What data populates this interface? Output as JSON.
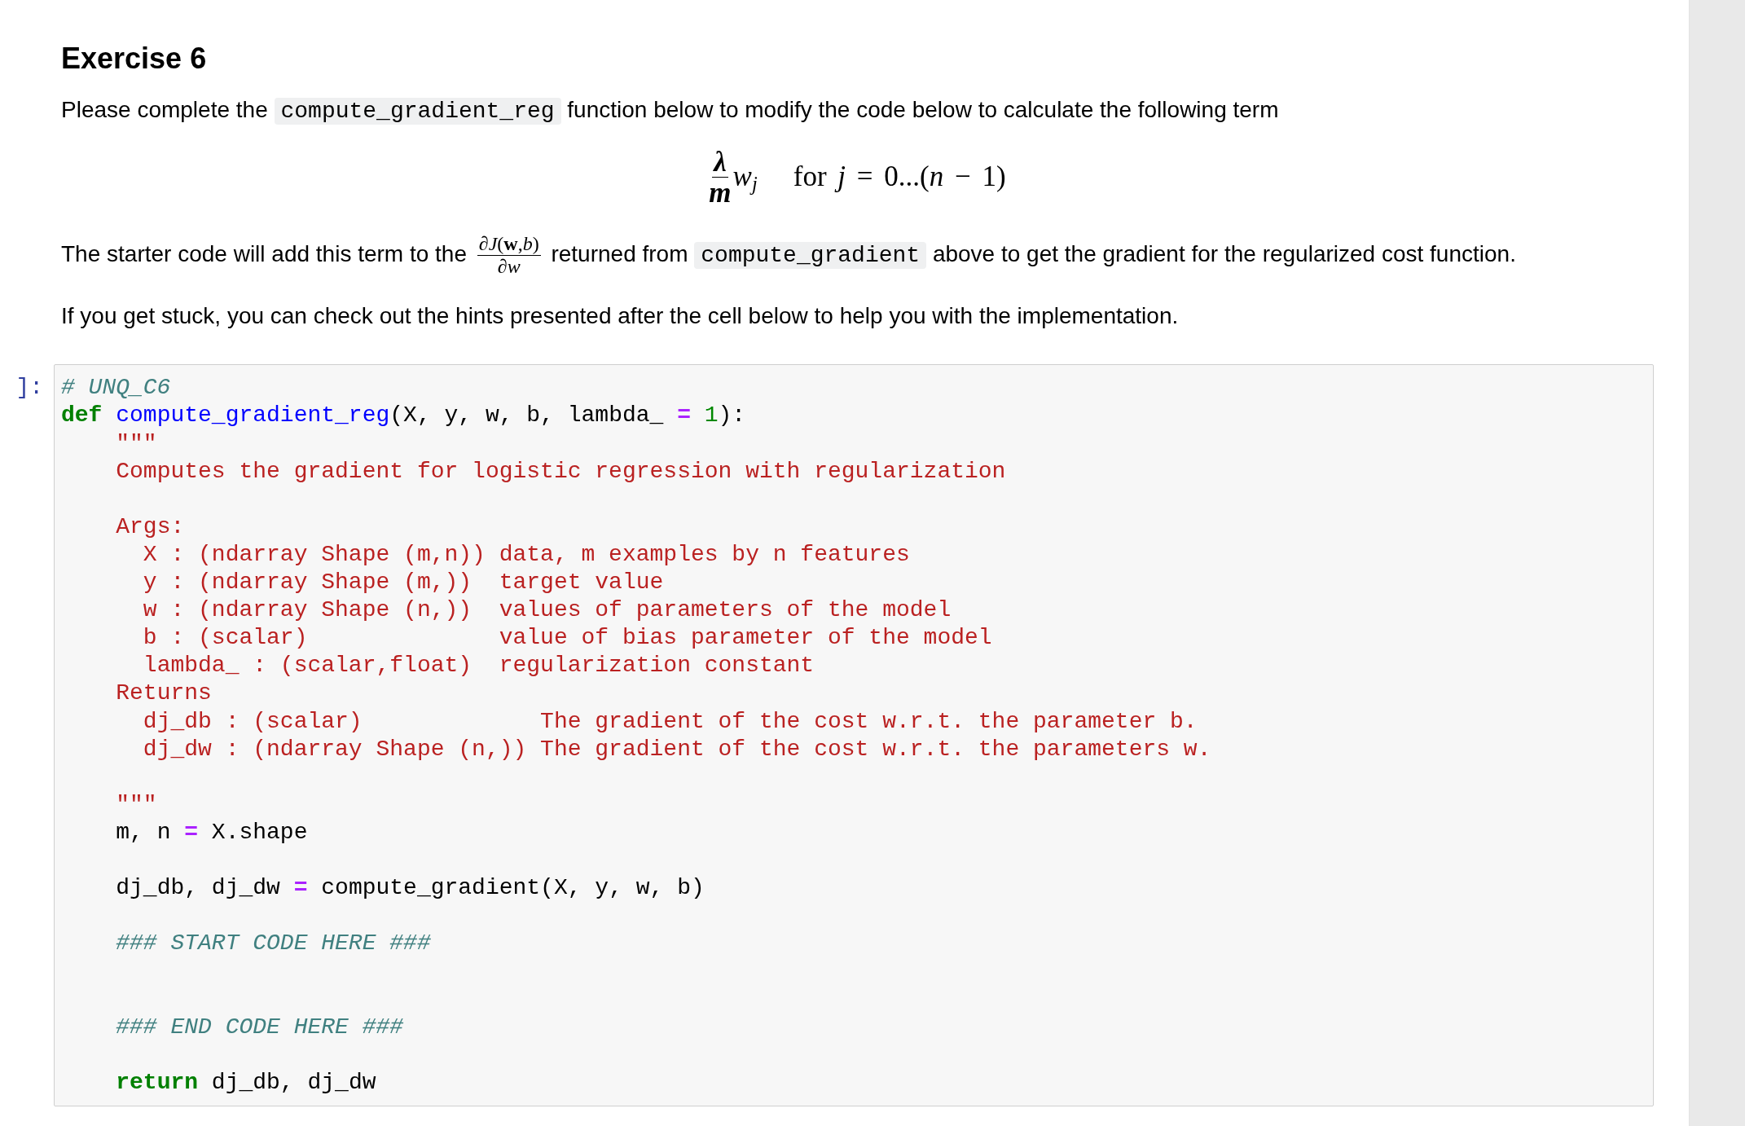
{
  "heading": "Exercise 6",
  "blocks": [
    {
      "kind": "paragraph",
      "parts": [
        {
          "kind": "text",
          "text": "Please complete the "
        },
        {
          "kind": "code",
          "text": "compute_gradient_reg"
        },
        {
          "kind": "text",
          "text": " function below to modify the code below to calculate the following term"
        }
      ]
    },
    {
      "kind": "display_math",
      "numerator": "λ",
      "denominator": "m",
      "term": "w$_{j}$",
      "condition": "for *j* = 0...(*n* − 1)"
    },
    {
      "kind": "paragraph",
      "parts": [
        {
          "kind": "text",
          "text": "The starter code will add this term to the "
        },
        {
          "kind": "fraction",
          "numerator": "∂*J*(**w**,*b*)",
          "denominator": "∂*w*"
        },
        {
          "kind": "text",
          "text": " returned from "
        },
        {
          "kind": "code",
          "text": "compute_gradient"
        },
        {
          "kind": "text",
          "text": " above to get the gradient for the regularized cost function."
        }
      ]
    },
    {
      "kind": "paragraph",
      "parts": [
        {
          "kind": "text",
          "text": "If you get stuck, you can check out the hints presented after the cell below to help you with the implementation."
        }
      ]
    },
    {
      "kind": "code_cell",
      "prompt": "]:",
      "lines": [
        {
          "kind": "code",
          "tokens": [
            {
              "kind": "comment",
              "text": "# UNQ_C6"
            }
          ]
        },
        {
          "kind": "code",
          "tokens": [
            {
              "kind": "keyword",
              "text": "def"
            },
            {
              "kind": "function",
              "text": " compute_gradient_reg"
            },
            {
              "kind": "plain",
              "text": "(X, y, w, b, lambda_ "
            },
            {
              "kind": "operator",
              "text": "="
            },
            {
              "kind": "number",
              "text": " 1"
            },
            {
              "kind": "plain",
              "text": "):"
            }
          ]
        },
        {
          "kind": "code",
          "tokens": [
            {
              "kind": "string",
              "text": "    \"\"\""
            }
          ]
        },
        {
          "kind": "code",
          "tokens": [
            {
              "kind": "string",
              "text": "    Computes the gradient for logistic regression with regularization"
            }
          ]
        },
        {
          "kind": "blank"
        },
        {
          "kind": "code",
          "tokens": [
            {
              "kind": "string",
              "text": "    Args:"
            }
          ]
        },
        {
          "kind": "code",
          "tokens": [
            {
              "kind": "string",
              "text": "      X : (ndarray Shape (m,n)) data, m examples by n features"
            }
          ]
        },
        {
          "kind": "code",
          "tokens": [
            {
              "kind": "string",
              "text": "      y : (ndarray Shape (m,))  target value"
            }
          ]
        },
        {
          "kind": "code",
          "tokens": [
            {
              "kind": "string",
              "text": "      w : (ndarray Shape (n,))  values of parameters of the model"
            }
          ]
        },
        {
          "kind": "code",
          "tokens": [
            {
              "kind": "string",
              "text": "      b : (scalar)              value of bias parameter of the model"
            }
          ]
        },
        {
          "kind": "code",
          "tokens": [
            {
              "kind": "string",
              "text": "      lambda_ : (scalar,float)  regularization constant"
            }
          ]
        },
        {
          "kind": "code",
          "tokens": [
            {
              "kind": "string",
              "text": "    Returns"
            }
          ]
        },
        {
          "kind": "code",
          "tokens": [
            {
              "kind": "string",
              "text": "      dj_db : (scalar)             The gradient of the cost w.r.t. the parameter b."
            }
          ]
        },
        {
          "kind": "code",
          "tokens": [
            {
              "kind": "string",
              "text": "      dj_dw : (ndarray Shape (n,)) The gradient of the cost w.r.t. the parameters w."
            }
          ]
        },
        {
          "kind": "blank"
        },
        {
          "kind": "code",
          "tokens": [
            {
              "kind": "string",
              "text": "    \"\"\""
            }
          ]
        },
        {
          "kind": "code",
          "tokens": [
            {
              "kind": "plain",
              "text": "    m, n "
            },
            {
              "kind": "operator",
              "text": "="
            },
            {
              "kind": "plain",
              "text": " X.shape"
            }
          ]
        },
        {
          "kind": "blank"
        },
        {
          "kind": "code",
          "tokens": [
            {
              "kind": "plain",
              "text": "    dj_db, dj_dw "
            },
            {
              "kind": "operator",
              "text": "="
            },
            {
              "kind": "plain",
              "text": " compute_gradient(X, y, w, b)"
            }
          ]
        },
        {
          "kind": "blank"
        },
        {
          "kind": "code",
          "tokens": [
            {
              "kind": "comment",
              "text": "    ### START CODE HERE ###"
            }
          ]
        },
        {
          "kind": "blank"
        },
        {
          "kind": "blank"
        },
        {
          "kind": "code",
          "tokens": [
            {
              "kind": "comment",
              "text": "    ### END CODE HERE ###"
            }
          ]
        },
        {
          "kind": "blank"
        },
        {
          "kind": "code",
          "tokens": [
            {
              "kind": "keyword",
              "text": "    return"
            },
            {
              "kind": "plain",
              "text": " dj_db, dj_dw"
            }
          ]
        }
      ]
    }
  ]
}
